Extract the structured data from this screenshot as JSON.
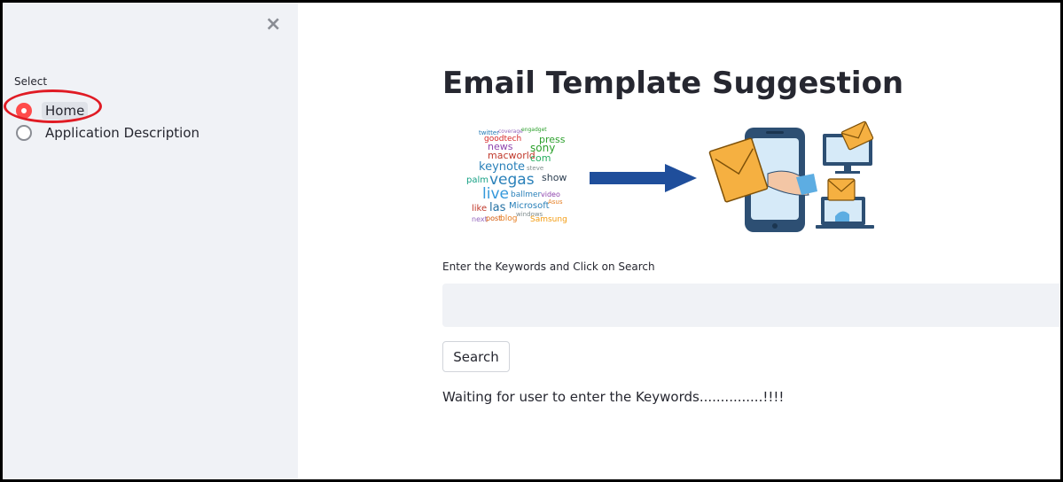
{
  "sidebar": {
    "close_glyph": "×",
    "select_label": "Select",
    "options": [
      {
        "label": "Home",
        "selected": true
      },
      {
        "label": "Application Description",
        "selected": false
      }
    ]
  },
  "main": {
    "title": "Email Template Suggestion",
    "input_label": "Enter the Keywords and Click on Search",
    "input_value": "",
    "search_label": "Search",
    "status": "Waiting for user to enter the Keywords...............!!!!"
  },
  "hero": {
    "word_cloud": [
      {
        "word": "twitter",
        "color": "#1f77b4"
      },
      {
        "word": "coverage",
        "color": "#9467bd"
      },
      {
        "word": "engadget",
        "color": "#2ca02c"
      },
      {
        "word": "goodtech",
        "color": "#d62728"
      },
      {
        "word": "press",
        "color": "#2ca02c"
      },
      {
        "word": "news",
        "color": "#8e44ad"
      },
      {
        "word": "sony",
        "color": "#2ca02c"
      },
      {
        "word": "macworld",
        "color": "#c0392b"
      },
      {
        "word": "com",
        "color": "#27ae60"
      },
      {
        "word": "keynote",
        "color": "#2980b9"
      },
      {
        "word": "steve",
        "color": "#7f8c8d"
      },
      {
        "word": "vegas",
        "color": "#2980b9"
      },
      {
        "word": "show",
        "color": "#2c3e50"
      },
      {
        "word": "palm",
        "color": "#16a085"
      },
      {
        "word": "live",
        "color": "#3498db"
      },
      {
        "word": "ballmer",
        "color": "#2980b9"
      },
      {
        "word": "video",
        "color": "#8e44ad"
      },
      {
        "word": "las",
        "color": "#2471a3"
      },
      {
        "word": "like",
        "color": "#c0392b"
      },
      {
        "word": "Microsoft",
        "color": "#2980b9"
      },
      {
        "word": "Asus",
        "color": "#e67e22"
      },
      {
        "word": "windows",
        "color": "#7f8c8d"
      },
      {
        "word": "next",
        "color": "#9467bd"
      },
      {
        "word": "post",
        "color": "#d35400"
      },
      {
        "word": "blog",
        "color": "#e67e22"
      },
      {
        "word": "Samsung",
        "color": "#f39c12"
      }
    ],
    "arrow_color": "#1f4e9b"
  },
  "colors": {
    "accent": "#ff4b4b",
    "sidebar_bg": "#f0f2f6",
    "annotation": "#e01b24"
  }
}
